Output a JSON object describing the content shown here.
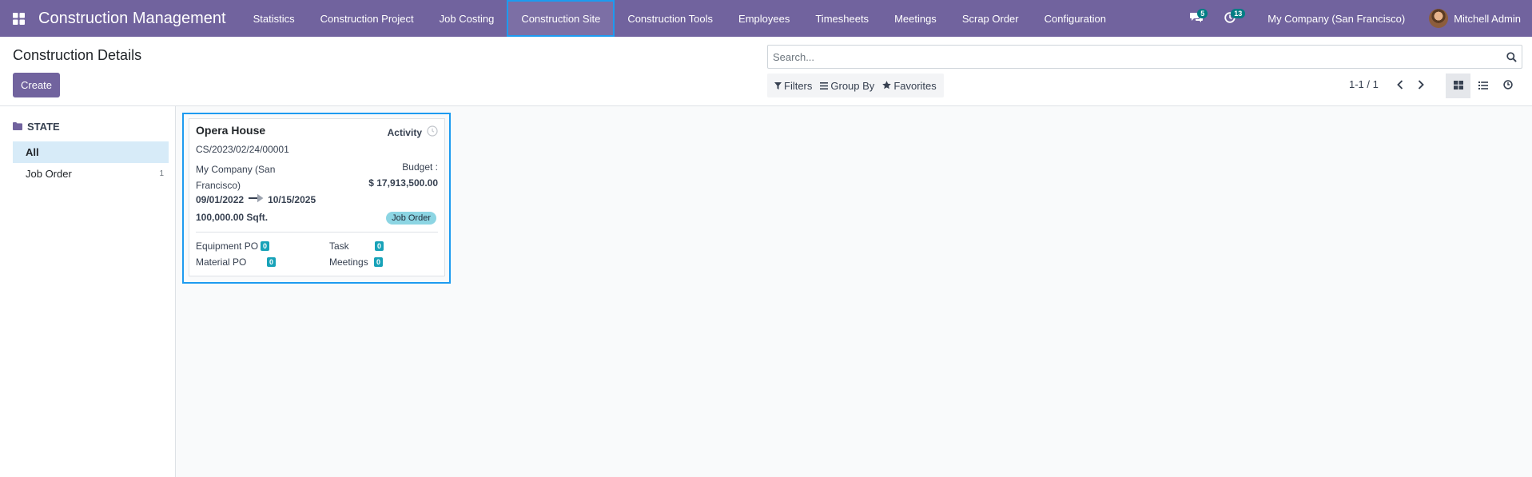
{
  "navbar": {
    "brand": "Construction Management",
    "menu": [
      {
        "label": "Statistics"
      },
      {
        "label": "Construction Project"
      },
      {
        "label": "Job Costing"
      },
      {
        "label": "Construction Site"
      },
      {
        "label": "Construction Tools"
      },
      {
        "label": "Employees"
      },
      {
        "label": "Timesheets"
      },
      {
        "label": "Meetings"
      },
      {
        "label": "Scrap Order"
      },
      {
        "label": "Configuration"
      }
    ],
    "messages_count": "5",
    "activities_count": "13",
    "company": "My Company (San Francisco)",
    "user": "Mitchell Admin"
  },
  "control_panel": {
    "title": "Construction Details",
    "create_label": "Create",
    "search_placeholder": "Search...",
    "filters_label": "Filters",
    "groupby_label": "Group By",
    "favorites_label": "Favorites",
    "pager": "1-1 / 1"
  },
  "sidebar": {
    "header": "STATE",
    "items": [
      {
        "label": "All",
        "count": ""
      },
      {
        "label": "Job Order",
        "count": "1"
      }
    ]
  },
  "card": {
    "title": "Opera House",
    "activity_label": "Activity",
    "reference": "CS/2023/02/24/00001",
    "company": "My Company (San Francisco)",
    "budget_label": "Budget :",
    "budget": "$ 17,913,500.00",
    "start_date": "09/01/2022",
    "end_date": "10/15/2025",
    "area": "100,000.00 Sqft.",
    "status": "Job Order",
    "stats": [
      {
        "label": "Equipment PO",
        "value": "0"
      },
      {
        "label": "Task",
        "value": "0"
      },
      {
        "label": "Material PO",
        "value": "0"
      },
      {
        "label": "Meetings",
        "value": "0"
      }
    ]
  },
  "colors": {
    "navbar": "#71639e",
    "accent": "#017e84",
    "highlight": "#1d9bf0",
    "tag": "#8cd5e3",
    "stat_badge": "#17a2b8"
  }
}
